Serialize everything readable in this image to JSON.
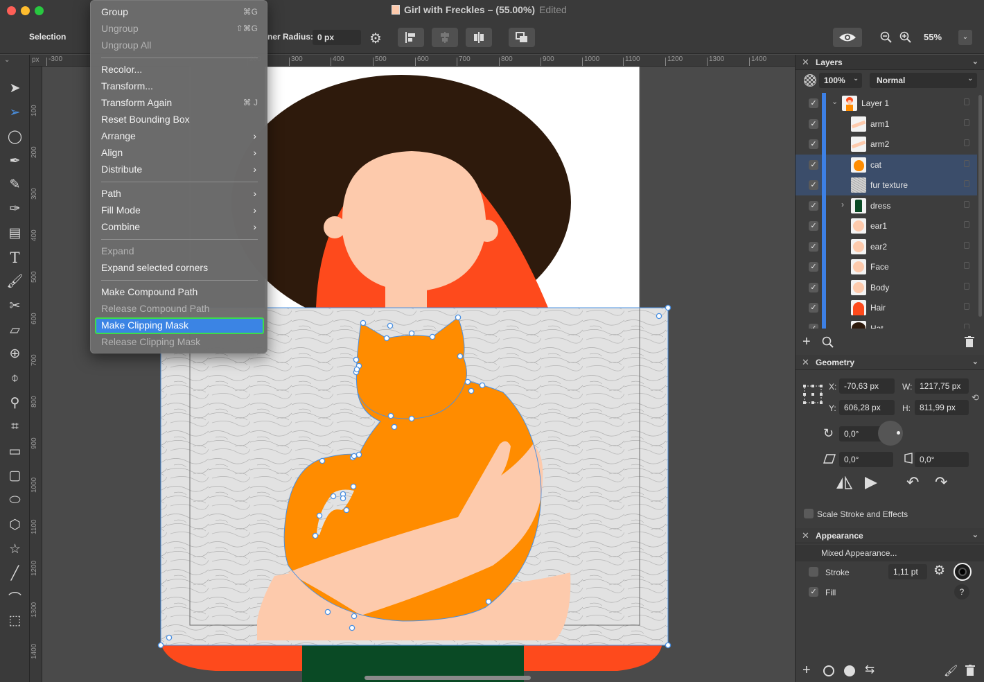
{
  "window": {
    "title": "Girl with Freckles – (55.00%)",
    "status": "Edited"
  },
  "toolbar": {
    "mode_label": "Selection",
    "corner_radius_label": "ner Radius:",
    "corner_radius_value": "0 px",
    "zoom_value": "55%"
  },
  "tools": [
    "arrow-select-icon",
    "direct-select-icon",
    "lasso-icon",
    "pen-icon",
    "pencil-icon",
    "vector-brush-icon",
    "gradient-icon",
    "text-icon",
    "brush-icon",
    "scissors-icon",
    "eraser-icon",
    "shape-builder-icon",
    "eyedropper-icon",
    "zoom-icon",
    "crop-icon",
    "rectangle-icon",
    "rounded-rectangle-icon",
    "ellipse-icon",
    "polygon-icon",
    "star-icon",
    "line-icon",
    "arc-icon",
    "frame-icon"
  ],
  "ruler": {
    "unit": "px",
    "top_labels": [
      "-300",
      "200",
      "300",
      "400",
      "500",
      "600",
      "700",
      "800",
      "900",
      "1000",
      "1100",
      "1200",
      "1300",
      "1400"
    ],
    "left_labels": [
      "100",
      "200",
      "300",
      "400",
      "500",
      "600",
      "700",
      "800",
      "900",
      "1000",
      "1100",
      "1200",
      "1300",
      "1400"
    ]
  },
  "context_menu": {
    "items": [
      {
        "label": "Group",
        "shortcut": "⌘G",
        "enabled": true
      },
      {
        "label": "Ungroup",
        "shortcut": "⇧⌘G",
        "enabled": false
      },
      {
        "label": "Ungroup All",
        "shortcut": "",
        "enabled": false
      },
      {
        "label": "Recolor...",
        "enabled": true
      },
      {
        "label": "Transform...",
        "enabled": true
      },
      {
        "label": "Transform Again",
        "shortcut": "⌘ J",
        "enabled": true
      },
      {
        "label": "Reset Bounding Box",
        "enabled": true
      },
      {
        "label": "Arrange",
        "submenu": true,
        "enabled": true
      },
      {
        "label": "Align",
        "submenu": true,
        "enabled": true
      },
      {
        "label": "Distribute",
        "submenu": true,
        "enabled": true
      },
      {
        "label": "Path",
        "submenu": true,
        "enabled": true
      },
      {
        "label": "Fill Mode",
        "submenu": true,
        "enabled": true
      },
      {
        "label": "Combine",
        "submenu": true,
        "enabled": true
      },
      {
        "label": "Expand",
        "enabled": false
      },
      {
        "label": "Expand selected corners",
        "enabled": true
      },
      {
        "label": "Make Compound Path",
        "enabled": true
      },
      {
        "label": "Release Compound Path",
        "enabled": false
      },
      {
        "label": "Make Clipping Mask",
        "enabled": true,
        "highlighted": true
      },
      {
        "label": "Release Clipping Mask",
        "enabled": false
      }
    ]
  },
  "layers_panel": {
    "title": "Layers",
    "opacity": "100%",
    "blend_mode": "Normal",
    "layers": [
      {
        "name": "Layer 1",
        "visible": true,
        "selected": false,
        "thumb": "layer",
        "expanded": true
      },
      {
        "name": "arm1",
        "visible": true,
        "selected": false,
        "thumb": "arm"
      },
      {
        "name": "arm2",
        "visible": true,
        "selected": false,
        "thumb": "arm"
      },
      {
        "name": "cat",
        "visible": true,
        "selected": true,
        "thumb": "cat"
      },
      {
        "name": "fur texture",
        "visible": true,
        "selected": true,
        "thumb": "fur"
      },
      {
        "name": "dress",
        "visible": true,
        "selected": false,
        "thumb": "dress",
        "group": true
      },
      {
        "name": "ear1",
        "visible": true,
        "selected": false,
        "thumb": "skin"
      },
      {
        "name": "ear2",
        "visible": true,
        "selected": false,
        "thumb": "skin"
      },
      {
        "name": "Face",
        "visible": true,
        "selected": false,
        "thumb": "skin"
      },
      {
        "name": "Body",
        "visible": true,
        "selected": false,
        "thumb": "skin"
      },
      {
        "name": "Hair",
        "visible": true,
        "selected": false,
        "thumb": "hair"
      },
      {
        "name": "Hat",
        "visible": true,
        "selected": false,
        "thumb": "hat"
      }
    ]
  },
  "geometry_panel": {
    "title": "Geometry",
    "x_label": "X:",
    "x": "-70,63 px",
    "y_label": "Y:",
    "y": "606,28 px",
    "w_label": "W:",
    "w": "1217,75 px",
    "h_label": "H:",
    "h": "811,99 px",
    "rotation": "0,0°",
    "shear": "0,0°",
    "skew": "0,0°",
    "scale_stroke_label": "Scale Stroke and Effects"
  },
  "appearance_panel": {
    "title": "Appearance",
    "mixed_label": "Mixed Appearance...",
    "stroke_label": "Stroke",
    "stroke_width": "1,11 pt",
    "fill_label": "Fill",
    "help": "?"
  },
  "colors": {
    "hat": "#2e1a0c",
    "hair": "#fe4a1c",
    "skin": "#fdcaac",
    "cat": "#ff8c00",
    "dress": "#0a4a25",
    "selection": "#4a90e2",
    "menu_highlight": "#3b84e4"
  }
}
